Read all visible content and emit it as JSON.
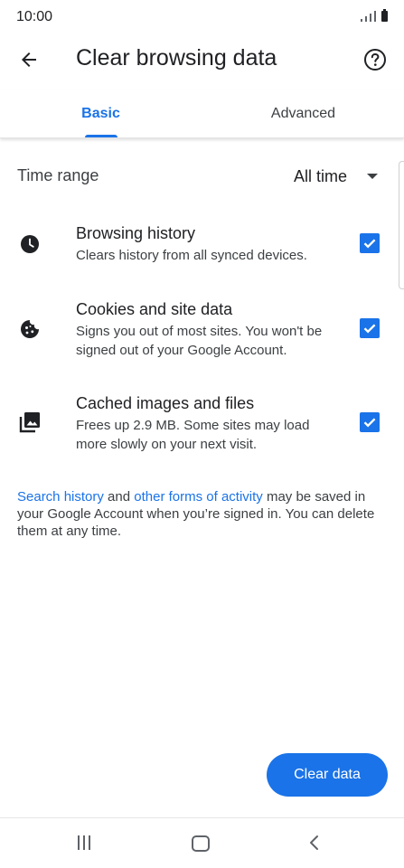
{
  "status_bar": {
    "time": "10:00"
  },
  "app_bar": {
    "title": "Clear browsing data"
  },
  "tabs": [
    {
      "label": "Basic",
      "selected": true
    },
    {
      "label": "Advanced",
      "selected": false
    }
  ],
  "time_range": {
    "label": "Time range",
    "value": "All time"
  },
  "options": [
    {
      "icon": "clock-icon",
      "title": "Browsing history",
      "description": "Clears history from all synced devices.",
      "checked": true
    },
    {
      "icon": "cookie-icon",
      "title": "Cookies and site data",
      "description": "Signs you out of most sites. You won't be signed out of your Google Account.",
      "checked": true
    },
    {
      "icon": "image-stack-icon",
      "title": "Cached images and files",
      "description": "Frees up 2.9 MB. Some sites may load more slowly on your next visit.",
      "checked": true
    }
  ],
  "footer_note": {
    "link1": "Search history",
    "text1": " and ",
    "link2": "other forms of activity",
    "text2": " may be saved in your Google Account when you’re signed in. You can delete them at any time."
  },
  "clear_button": {
    "label": "Clear data"
  },
  "colors": {
    "accent": "#1a73e8",
    "text": "#202124",
    "secondary_text": "#3c4043"
  }
}
